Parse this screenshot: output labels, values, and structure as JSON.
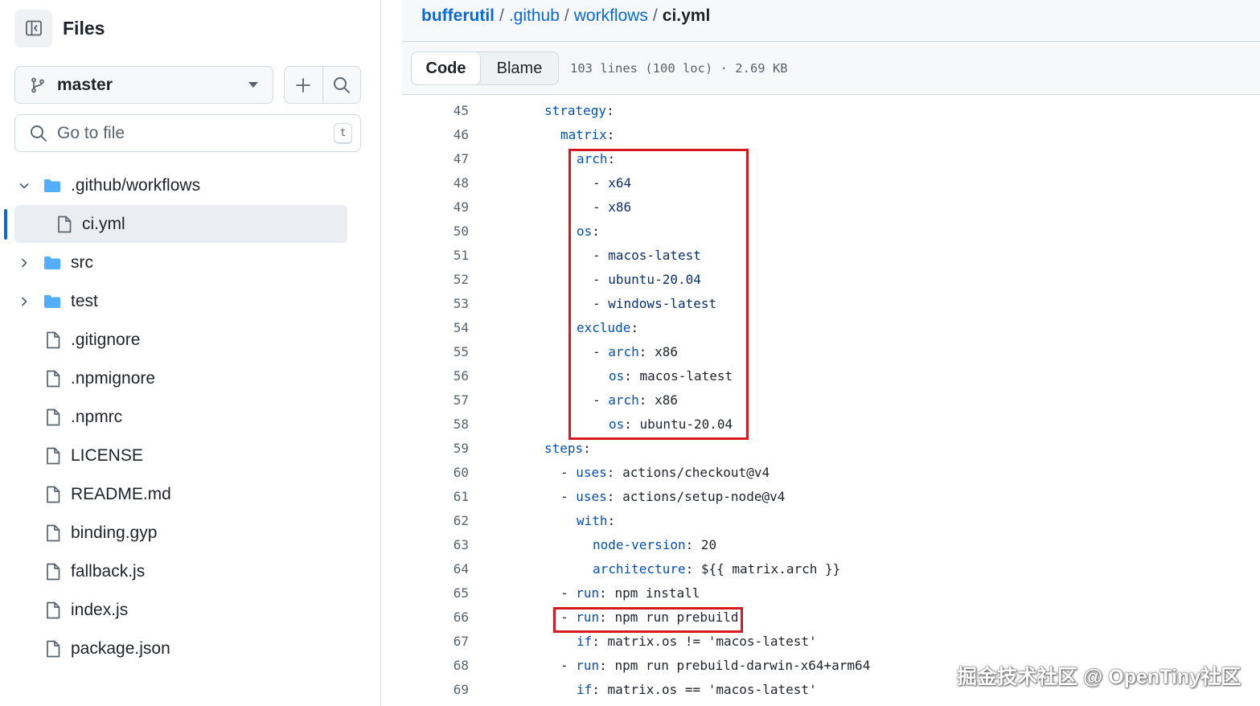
{
  "sidebar": {
    "title": "Files",
    "branch": "master",
    "goto_placeholder": "Go to file",
    "goto_shortcut": "t",
    "tree": [
      {
        "label": ".github/workflows",
        "type": "folder",
        "expanded": true,
        "depth": 0
      },
      {
        "label": "ci.yml",
        "type": "file",
        "selected": true,
        "depth": 1
      },
      {
        "label": "src",
        "type": "folder",
        "expanded": false,
        "depth": 0
      },
      {
        "label": "test",
        "type": "folder",
        "expanded": false,
        "depth": 0
      },
      {
        "label": ".gitignore",
        "type": "file",
        "depth": 0
      },
      {
        "label": ".npmignore",
        "type": "file",
        "depth": 0
      },
      {
        "label": ".npmrc",
        "type": "file",
        "depth": 0
      },
      {
        "label": "LICENSE",
        "type": "file",
        "depth": 0
      },
      {
        "label": "README.md",
        "type": "file",
        "depth": 0
      },
      {
        "label": "binding.gyp",
        "type": "file",
        "depth": 0
      },
      {
        "label": "fallback.js",
        "type": "file",
        "depth": 0
      },
      {
        "label": "index.js",
        "type": "file",
        "depth": 0
      },
      {
        "label": "package.json",
        "type": "file",
        "depth": 0
      }
    ]
  },
  "breadcrumb": {
    "repo": "bufferutil",
    "parts": [
      ".github",
      "workflows"
    ],
    "current": "ci.yml"
  },
  "filebar": {
    "code_label": "Code",
    "blame_label": "Blame",
    "info": "103 lines (100 loc) · 2.69 KB"
  },
  "code_lines": [
    {
      "n": "45",
      "indent": 0,
      "k": "strategy",
      "v": ""
    },
    {
      "n": "46",
      "indent": 1,
      "k": "matrix",
      "v": ""
    },
    {
      "n": "47",
      "indent": 2,
      "k": "arch",
      "v": ""
    },
    {
      "n": "48",
      "indent": 3,
      "dash": true,
      "k": "",
      "v": "x64"
    },
    {
      "n": "49",
      "indent": 3,
      "dash": true,
      "k": "",
      "v": "x86"
    },
    {
      "n": "50",
      "indent": 2,
      "k": "os",
      "v": ""
    },
    {
      "n": "51",
      "indent": 3,
      "dash": true,
      "k": "",
      "v": "macos-latest"
    },
    {
      "n": "52",
      "indent": 3,
      "dash": true,
      "k": "",
      "v": "ubuntu-20.04"
    },
    {
      "n": "53",
      "indent": 3,
      "dash": true,
      "k": "",
      "v": "windows-latest"
    },
    {
      "n": "54",
      "indent": 2,
      "k": "exclude",
      "v": ""
    },
    {
      "n": "55",
      "indent": 3,
      "dash": true,
      "k": "arch",
      "v": "x86"
    },
    {
      "n": "56",
      "indent": 4,
      "k": "os",
      "v": "macos-latest"
    },
    {
      "n": "57",
      "indent": 3,
      "dash": true,
      "k": "arch",
      "v": "x86"
    },
    {
      "n": "58",
      "indent": 4,
      "k": "os",
      "v": "ubuntu-20.04"
    },
    {
      "n": "59",
      "indent": 0,
      "k": "steps",
      "v": ""
    },
    {
      "n": "60",
      "indent": 1,
      "dash": true,
      "k": "uses",
      "v": "actions/checkout@v4"
    },
    {
      "n": "61",
      "indent": 1,
      "dash": true,
      "k": "uses",
      "v": "actions/setup-node@v4"
    },
    {
      "n": "62",
      "indent": 2,
      "k": "with",
      "v": ""
    },
    {
      "n": "63",
      "indent": 3,
      "k": "node-version",
      "v": "20"
    },
    {
      "n": "64",
      "indent": 3,
      "k": "architecture",
      "v": "${{ matrix.arch }}"
    },
    {
      "n": "65",
      "indent": 1,
      "dash": true,
      "k": "run",
      "v": "npm install"
    },
    {
      "n": "66",
      "indent": 1,
      "dash": true,
      "k": "run",
      "v": "npm run prebuild"
    },
    {
      "n": "67",
      "indent": 2,
      "k": "if",
      "v": "matrix.os != 'macos-latest'"
    },
    {
      "n": "68",
      "indent": 1,
      "dash": true,
      "k": "run",
      "v": "npm run prebuild-darwin-x64+arm64"
    },
    {
      "n": "69",
      "indent": 2,
      "k": "if",
      "v": "matrix.os == 'macos-latest'"
    }
  ],
  "highlights": [
    {
      "from": "47",
      "to": "58"
    },
    {
      "from": "66",
      "to": "66"
    }
  ],
  "watermark": "掘金技术社区 @ OpenTiny社区",
  "colors": {
    "link": "#0969da",
    "key": "#0550ae",
    "value": "#0a3069",
    "highlight_border": "#d6191f",
    "folder": "#54aeff"
  }
}
